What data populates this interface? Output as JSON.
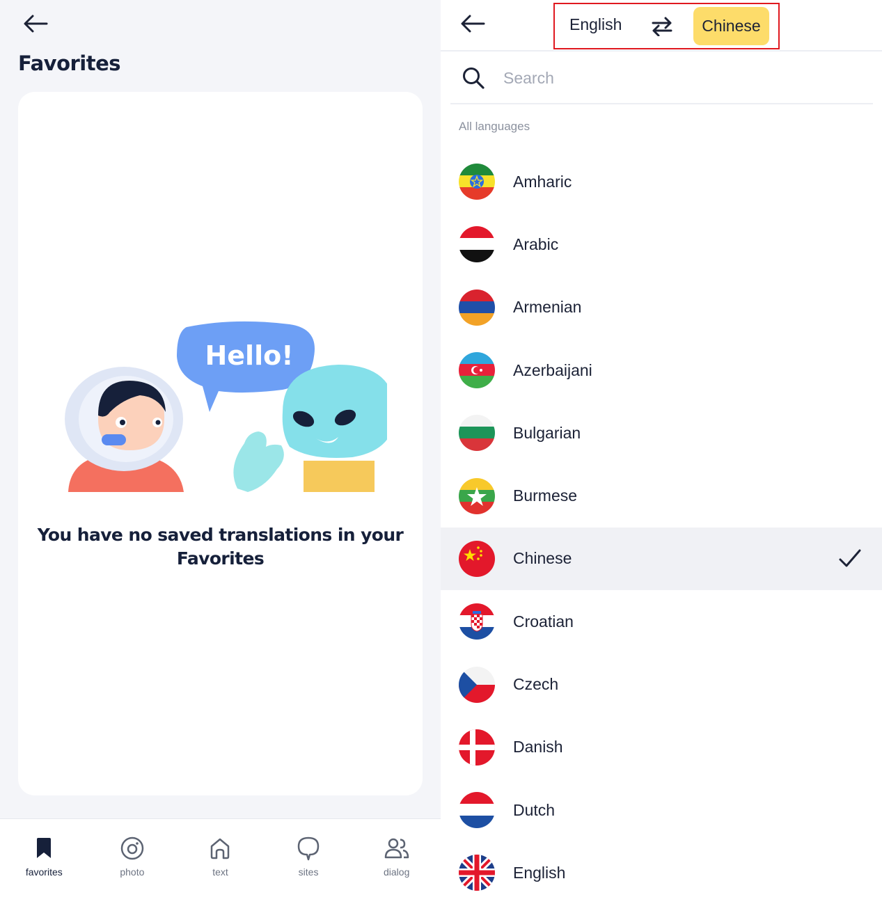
{
  "favorites_screen": {
    "title": "Favorites",
    "illustration_text": "Hello!",
    "empty_message": "You have no saved translations in your Favorites"
  },
  "bottom_nav": [
    {
      "label": "favorites",
      "icon": "bookmark-icon",
      "active": true
    },
    {
      "label": "photo",
      "icon": "camera-icon",
      "active": false
    },
    {
      "label": "text",
      "icon": "home-icon",
      "active": false
    },
    {
      "label": "sites",
      "icon": "chat-bubble-icon",
      "active": false
    },
    {
      "label": "dialog",
      "icon": "people-icon",
      "active": false
    }
  ],
  "language_picker": {
    "source_language": "English",
    "target_language": "Chinese",
    "search_placeholder": "Search",
    "section_label": "All languages",
    "languages": [
      {
        "name": "Amharic",
        "flag": "ethiopia-flag-icon"
      },
      {
        "name": "Arabic",
        "flag": "yemen-flag-icon"
      },
      {
        "name": "Armenian",
        "flag": "armenia-flag-icon"
      },
      {
        "name": "Azerbaijani",
        "flag": "azerbaijan-flag-icon"
      },
      {
        "name": "Bulgarian",
        "flag": "bulgaria-flag-icon"
      },
      {
        "name": "Burmese",
        "flag": "myanmar-flag-icon"
      },
      {
        "name": "Chinese",
        "flag": "china-flag-icon",
        "selected": true
      },
      {
        "name": "Croatian",
        "flag": "croatia-flag-icon"
      },
      {
        "name": "Czech",
        "flag": "czech-flag-icon"
      },
      {
        "name": "Danish",
        "flag": "denmark-flag-icon"
      },
      {
        "name": "Dutch",
        "flag": "netherlands-flag-icon"
      },
      {
        "name": "English",
        "flag": "uk-flag-icon"
      }
    ]
  },
  "colors": {
    "accent_yellow": "#fddc6a",
    "highlight_border": "#e0181f",
    "selected_row": "#f0f1f5",
    "text_dark": "#16203a"
  }
}
